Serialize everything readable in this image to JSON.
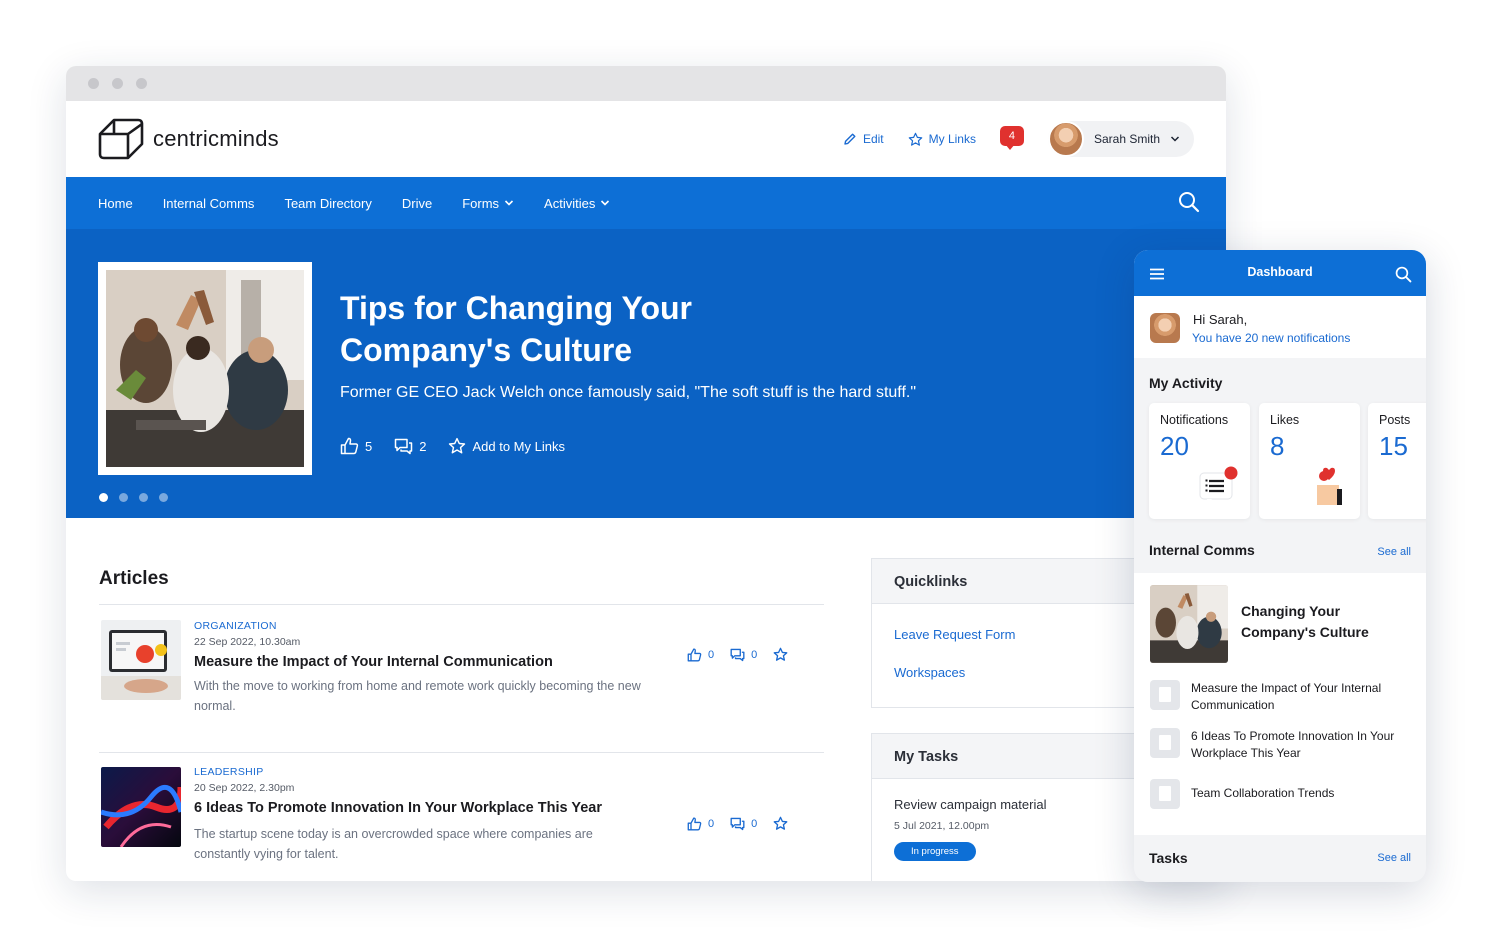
{
  "brand": {
    "name": "centricminds"
  },
  "header": {
    "edit_label": "Edit",
    "mylinks_label": "My Links",
    "notification_count": "4",
    "user_name": "Sarah Smith"
  },
  "nav": {
    "items": [
      {
        "label": "Home"
      },
      {
        "label": "Internal Comms"
      },
      {
        "label": "Team Directory"
      },
      {
        "label": "Drive"
      },
      {
        "label": "Forms"
      },
      {
        "label": "Activities"
      }
    ]
  },
  "hero": {
    "title": "Tips for Changing Your Company's Culture",
    "subtitle": "Former GE CEO Jack Welch once famously said, \"The soft stuff is the hard stuff.\"",
    "likes": "5",
    "comments": "2",
    "add_label": "Add to My Links",
    "slides": 4,
    "active_slide": 1
  },
  "articles": {
    "heading": "Articles",
    "items": [
      {
        "category": "ORGANIZATION",
        "date": "22 Sep 2022, 10.30am",
        "title": "Measure the Impact of Your Internal Communication",
        "desc": "With the move to working from home and remote work quickly becoming the new normal.",
        "likes": "0",
        "comments": "0"
      },
      {
        "category": "LEADERSHIP",
        "date": "20 Sep 2022, 2.30pm",
        "title": "6 Ideas To Promote Innovation In Your Workplace This Year",
        "desc": "The startup scene today is an overcrowded space where companies are constantly vying for talent.",
        "likes": "0",
        "comments": "0"
      }
    ]
  },
  "quicklinks": {
    "heading": "Quicklinks",
    "links": [
      {
        "label": "Leave Request Form"
      },
      {
        "label": "Workspaces"
      }
    ]
  },
  "tasks": {
    "heading": "My Tasks",
    "items": [
      {
        "title": "Review campaign material",
        "date": "5 Jul 2021, 12.00pm",
        "status": "In progress"
      }
    ]
  },
  "mobile": {
    "title": "Dashboard",
    "greeting": "Hi Sarah,",
    "notifications_text": "You have 20 new notifications",
    "activity_heading": "My Activity",
    "stats": [
      {
        "label": "Notifications",
        "value": "20"
      },
      {
        "label": "Likes",
        "value": "8"
      },
      {
        "label": "Posts",
        "value": "15"
      }
    ],
    "comms_heading": "Internal Comms",
    "see_all": "See all",
    "featured_title": "Changing Your Company's Culture",
    "comms_items": [
      {
        "title": "Measure the Impact of Your Internal Communication"
      },
      {
        "title": "6 Ideas To Promote Innovation In Your Workplace This Year"
      },
      {
        "title": "Team Collaboration Trends"
      }
    ],
    "tasks_heading": "Tasks",
    "tasks_see_all": "See all"
  },
  "colors": {
    "primary": "#0d6fd6",
    "hero_bg": "#0b62c4",
    "link": "#1a6ad1",
    "alert": "#e0312e"
  },
  "icons": [
    "logo-cube-icon",
    "pencil-icon",
    "star-icon",
    "chat-bubble-icon",
    "chevron-down-icon",
    "search-icon",
    "thumbs-up-icon",
    "comment-icon",
    "hamburger-icon",
    "document-icon",
    "heart-hand-icon"
  ]
}
